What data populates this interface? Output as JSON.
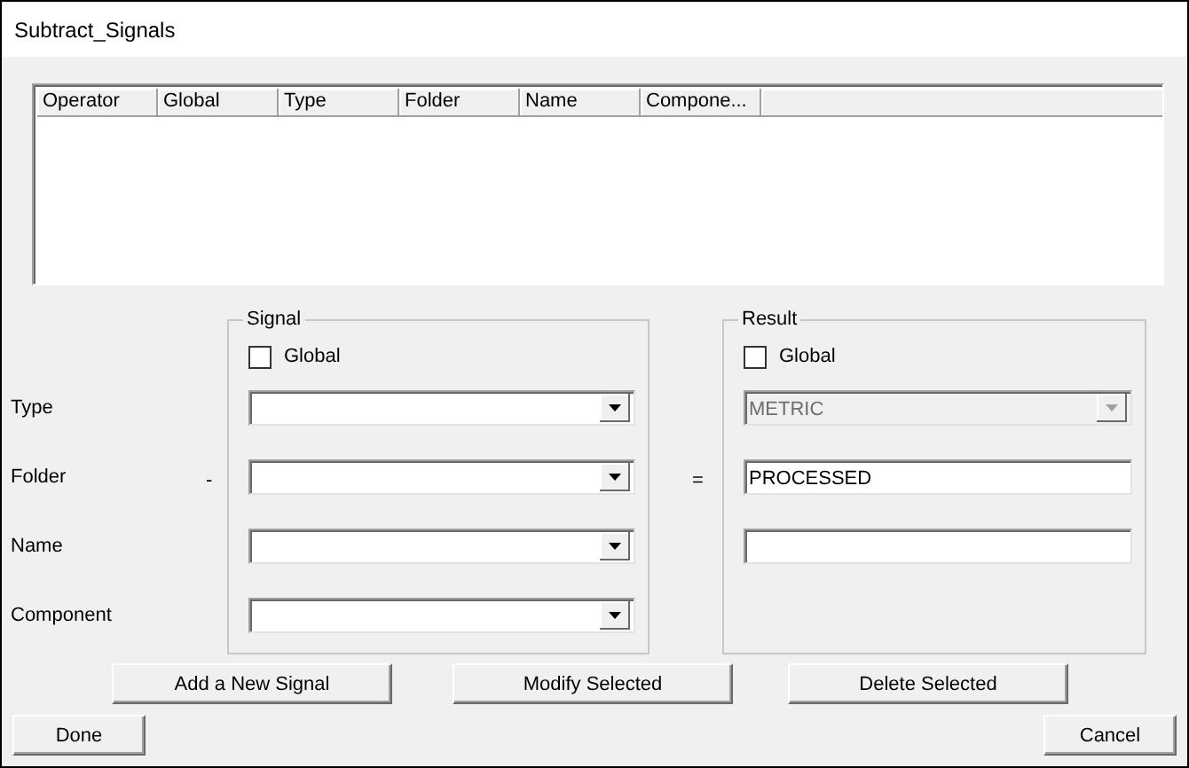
{
  "window": {
    "title": "Subtract_Signals"
  },
  "list": {
    "columns": [
      "Operator",
      "Global",
      "Type",
      "Folder",
      "Name",
      "Compone..."
    ]
  },
  "field_labels": [
    "Type",
    "Folder",
    "Name",
    "Component"
  ],
  "operator": "-",
  "equals": "=",
  "signal": {
    "title": "Signal",
    "global": {
      "label": "Global",
      "checked": false
    },
    "fields": [
      {
        "kind": "combo",
        "disabled": false
      },
      {
        "kind": "combo",
        "disabled": false
      },
      {
        "kind": "combo",
        "disabled": false
      },
      {
        "kind": "combo",
        "disabled": false
      }
    ]
  },
  "result": {
    "title": "Result",
    "global": {
      "label": "Global",
      "checked": false
    },
    "fields": [
      {
        "kind": "combo",
        "value": "METRIC",
        "disabled": true
      },
      {
        "kind": "text",
        "value": "PROCESSED"
      },
      {
        "kind": "text"
      }
    ]
  },
  "buttons": [
    "Add a New Signal",
    "Modify Selected",
    "Delete Selected"
  ],
  "done": "Done",
  "cancel": "Cancel"
}
